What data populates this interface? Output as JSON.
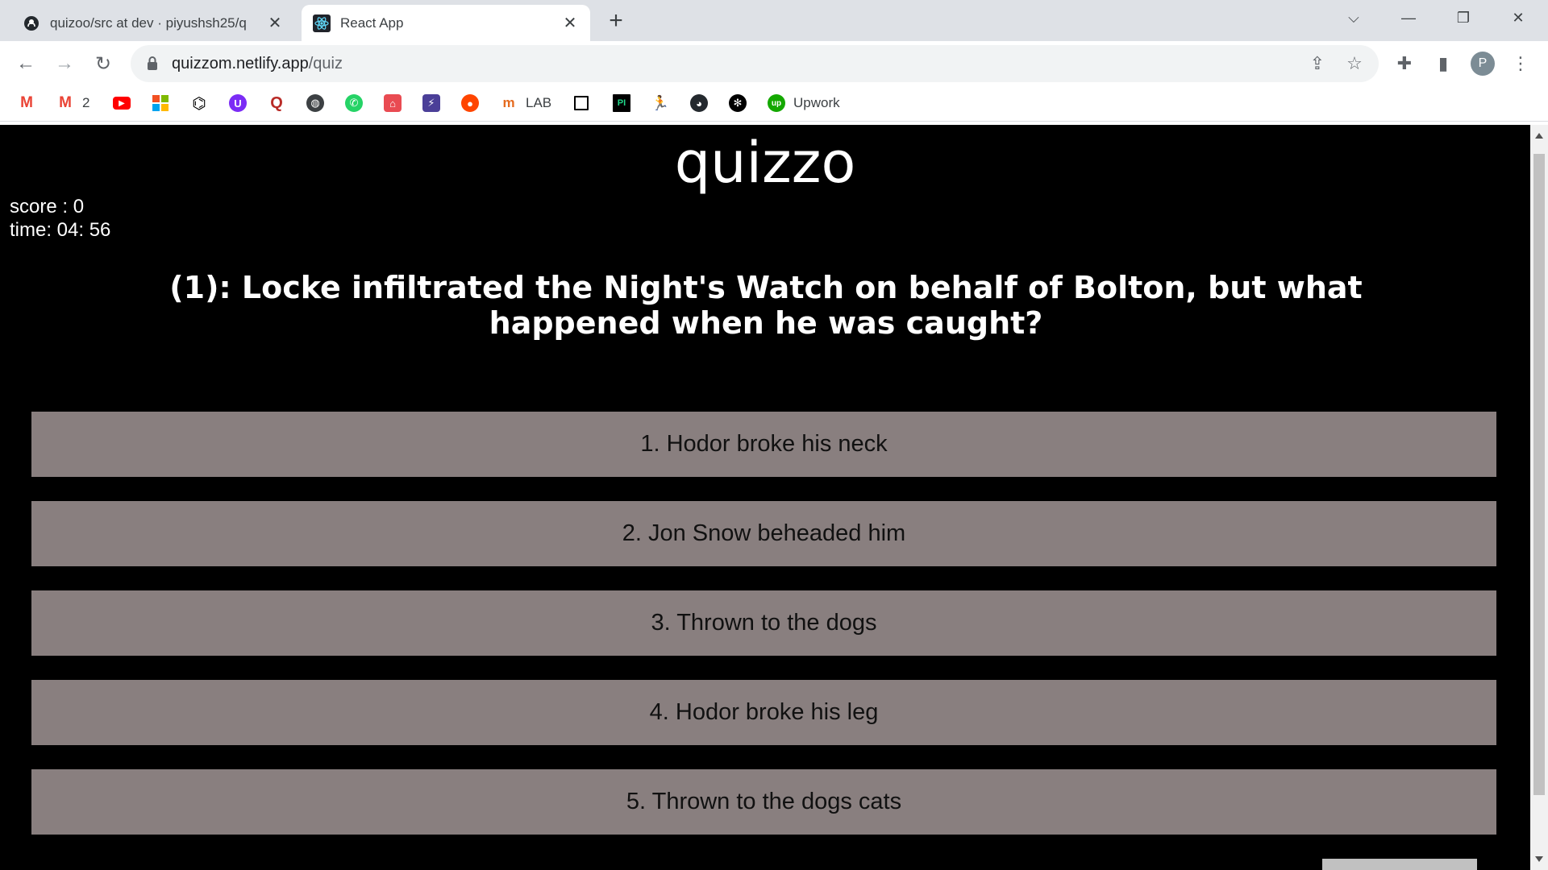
{
  "browser": {
    "tabs": [
      {
        "title": "quizoo/src at dev · piyushsh25/q",
        "icon": "github-icon",
        "active": false
      },
      {
        "title": "React App",
        "icon": "react-icon",
        "active": true
      }
    ],
    "url_host": "quizzom.netlify.app",
    "url_path": "/quiz",
    "bookmarks": [
      {
        "label": "",
        "icon": "gmail-icon"
      },
      {
        "label": "2",
        "icon": "gmail-icon"
      },
      {
        "label": "",
        "icon": "youtube-icon"
      },
      {
        "label": "",
        "icon": "microsoft-icon"
      },
      {
        "label": "",
        "icon": "codepen-icon"
      },
      {
        "label": "",
        "icon": "unacademy-icon"
      },
      {
        "label": "",
        "icon": "quora-icon"
      },
      {
        "label": "",
        "icon": "globe-icon"
      },
      {
        "label": "",
        "icon": "whatsapp-icon"
      },
      {
        "label": "",
        "icon": "store-icon"
      },
      {
        "label": "",
        "icon": "bolt-icon"
      },
      {
        "label": "",
        "icon": "reddit-icon"
      },
      {
        "label": "LAB",
        "icon": "lab-icon"
      },
      {
        "label": "",
        "icon": "square-icon"
      },
      {
        "label": "",
        "icon": "pi-icon"
      },
      {
        "label": "",
        "icon": "runner-icon"
      },
      {
        "label": "",
        "icon": "github-icon"
      },
      {
        "label": "",
        "icon": "openai-icon"
      },
      {
        "label": "Upwork",
        "icon": "upwork-icon"
      }
    ],
    "profile_initial": "P"
  },
  "app": {
    "title": "quizzo",
    "score_text": "score : 0",
    "time_text": "time: 04: 56",
    "question": "(1): Locke infiltrated the Night's Watch on behalf of Bolton, but what happened when he was caught?",
    "options": [
      "1. Hodor broke his neck",
      "2. Jon Snow beheaded him",
      "3. Thrown to the dogs",
      "4. Hodor broke his leg",
      "5. Thrown to the dogs cats"
    ]
  },
  "colors": {
    "page_bg": "#000000",
    "option_bg": "#897f7f",
    "text": "#ffffff"
  }
}
